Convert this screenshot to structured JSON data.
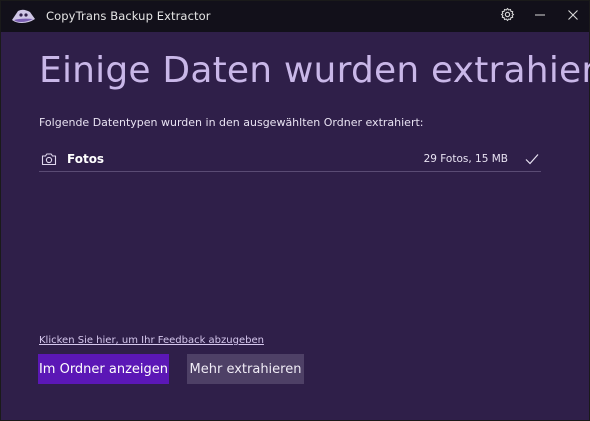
{
  "window": {
    "title": "CopyTrans Backup Extractor"
  },
  "icons": {
    "logo": "copytrans-logo-icon",
    "settings": "gear-icon",
    "minimize": "minimize-icon",
    "close": "close-icon",
    "camera": "camera-icon",
    "check": "checkmark-icon"
  },
  "main": {
    "headline": "Einige Daten wurden extrahiert",
    "subtitle": "Folgende Datentypen wurden in den ausgewählten Ordner extrahiert:",
    "items": [
      {
        "label": "Fotos",
        "summary": "29 Fotos, 15 MB",
        "status": "done"
      }
    ],
    "feedback_link": "Klicken Sie hier, um Ihr Feedback abzugeben",
    "primary_button": "Im Ordner anzeigen",
    "secondary_button": "Mehr extrahieren"
  },
  "colors": {
    "background": "#2f1f49",
    "titlebar": "#12101a",
    "headline": "#c9b7e8",
    "primary_button": "#5b17b6",
    "secondary_button": "#4e4066"
  }
}
